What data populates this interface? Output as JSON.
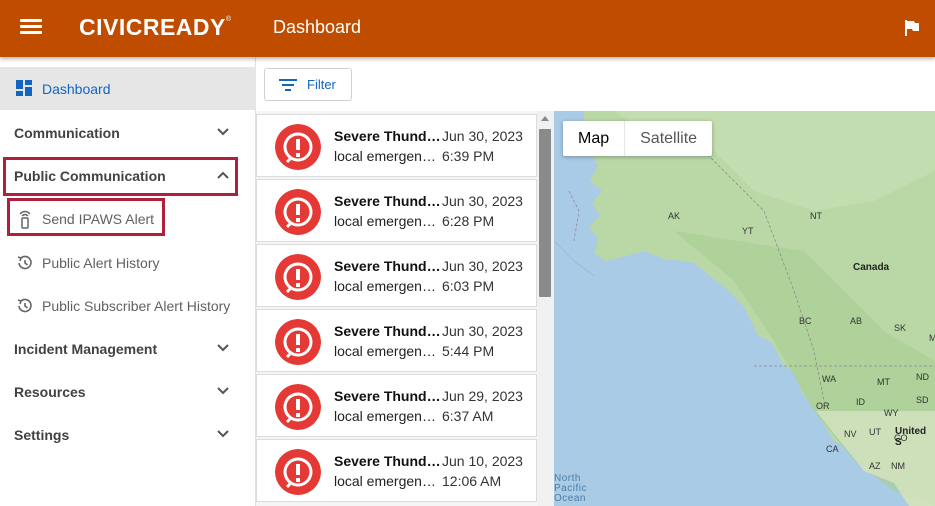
{
  "header": {
    "logo": "CIVICREADY",
    "logo_mark": "®",
    "title": "Dashboard"
  },
  "sidebar": {
    "dashboard": "Dashboard",
    "communication": "Communication",
    "public_communication": "Public Communication",
    "send_ipaws": "Send IPAWS Alert",
    "public_alert_history": "Public Alert History",
    "public_subscriber_alert_history": "Public Subscriber Alert History",
    "incident_management": "Incident Management",
    "resources": "Resources",
    "settings": "Settings"
  },
  "toolbar": {
    "filter_label": "Filter"
  },
  "alerts": [
    {
      "title": "Severe Thunderstorm Warning",
      "desc": "local emergency alert",
      "date": "Jun 30, 2023",
      "time": "6:39 PM"
    },
    {
      "title": "Severe Thunderstorm Warning",
      "desc": "local emergency alert",
      "date": "Jun 30, 2023",
      "time": "6:28 PM"
    },
    {
      "title": "Severe Thunderstorm Warning",
      "desc": "local emergency alert",
      "date": "Jun 30, 2023",
      "time": "6:03 PM"
    },
    {
      "title": "Severe Thunderstorm Warning",
      "desc": "local emergency alert",
      "date": "Jun 30, 2023",
      "time": "5:44 PM"
    },
    {
      "title": "Severe Thunderstorm Warning",
      "desc": "local emergency alert",
      "date": "Jun 29, 2023",
      "time": "6:37 AM"
    },
    {
      "title": "Severe Thunderstorm Warning",
      "desc": "local emergency alert",
      "date": "Jun 10, 2023",
      "time": "12:06 AM"
    }
  ],
  "map": {
    "map_button": "Map",
    "satellite_button": "Satellite",
    "labels": {
      "ak": "AK",
      "yt": "YT",
      "nt": "NT",
      "canada": "Canada",
      "bc": "BC",
      "ab": "AB",
      "sk": "SK",
      "mb": "MB",
      "wa": "WA",
      "mt": "MT",
      "nd": "ND",
      "or": "OR",
      "id": "ID",
      "wy": "WY",
      "sd": "SD",
      "nv": "NV",
      "ut": "UT",
      "co": "CO",
      "ca": "CA",
      "az": "AZ",
      "nm": "NM",
      "united_states": "United S",
      "ocean": "North Pacific Ocean"
    }
  },
  "colors": {
    "header": "#c04c00",
    "accent": "#1565c0",
    "alert_red": "#e53935",
    "highlight_box": "#b0203a"
  }
}
